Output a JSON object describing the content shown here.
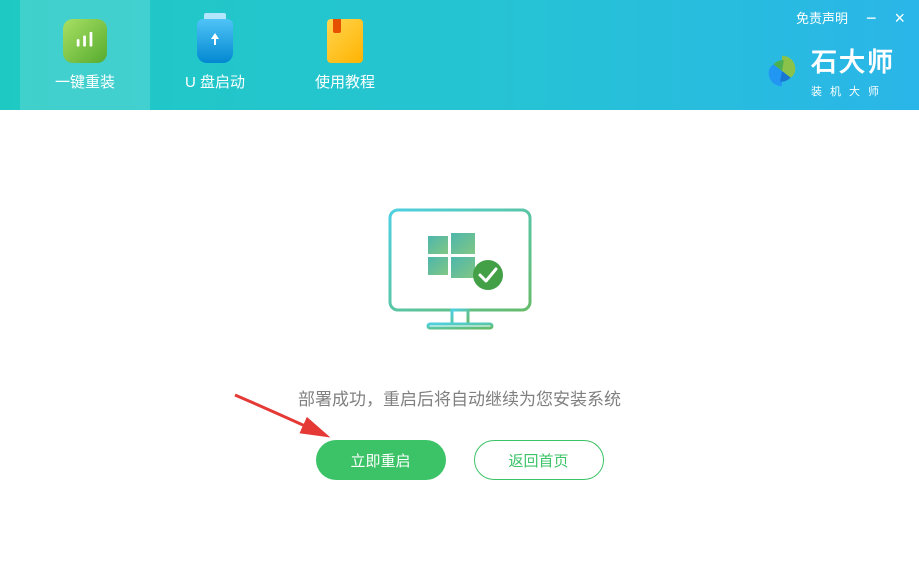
{
  "window": {
    "disclaimer": "免责声明"
  },
  "brand": {
    "title": "石大师",
    "subtitle": "装机大师"
  },
  "tabs": {
    "reinstall": "一键重装",
    "usb": "U 盘启动",
    "tutorial": "使用教程"
  },
  "content": {
    "status_message": "部署成功，重启后将自动继续为您安装系统",
    "restart_button": "立即重启",
    "home_button": "返回首页"
  }
}
